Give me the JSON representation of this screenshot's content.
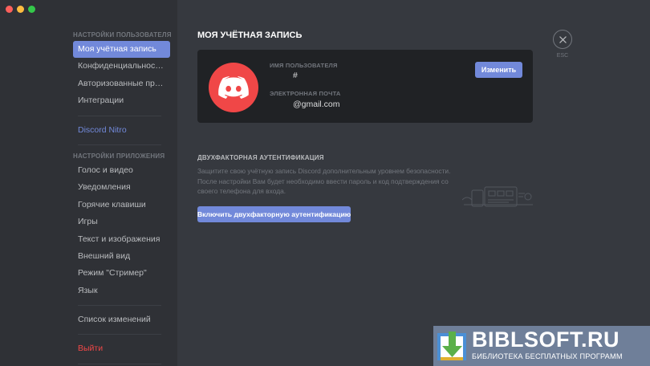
{
  "colors": {
    "window_traffic_lights": [
      "#fc605c",
      "#fdbc40",
      "#34c84a"
    ],
    "accent": "#7289da",
    "danger": "#f04747",
    "avatar_bg": "#f04747"
  },
  "sidebar": {
    "user_settings_header": "НАСТРОЙКИ ПОЛЬЗОВАТЕЛЯ",
    "user_items": [
      {
        "label": "Моя учётная запись",
        "active": true
      },
      {
        "label": "Конфиденциальность ..."
      },
      {
        "label": "Авторизованные прил..."
      },
      {
        "label": "Интеграции"
      }
    ],
    "nitro_label": "Discord Nitro",
    "app_settings_header": "НАСТРОЙКИ ПРИЛОЖЕНИЯ",
    "app_items": [
      {
        "label": "Голос и видео"
      },
      {
        "label": "Уведомления"
      },
      {
        "label": "Горячие клавиши"
      },
      {
        "label": "Игры"
      },
      {
        "label": "Текст и изображения"
      },
      {
        "label": "Внешний вид"
      },
      {
        "label": "Режим \"Стример\""
      },
      {
        "label": "Язык"
      }
    ],
    "changelog_label": "Список изменений",
    "logout_label": "Выйти",
    "social_icons": [
      "twitter-icon",
      "facebook-icon",
      "instagram-icon"
    ]
  },
  "main": {
    "title": "МОЯ УЧЁТНАЯ ЗАПИСЬ",
    "account": {
      "avatar_icon": "discord-logo-icon",
      "username_label": "ИМЯ ПОЛЬЗОВАТЕЛЯ",
      "username_value": "#",
      "email_label": "ЭЛЕКТРОННАЯ ПОЧТА",
      "email_value": "@gmail.com",
      "edit_button": "Изменить"
    },
    "two_factor": {
      "title": "ДВУХФАКТОРНАЯ АУТЕНТИФИКАЦИЯ",
      "description": "Защитите свою учётную запись Discord дополнительным уровнем безопасности. После настройки Вам будет необходимо ввести пароль и код подтверждения со своего телефона для входа.",
      "enable_button": "Включить двухфакторную аутентификацию",
      "illustration_icon": "phone-lock-illustration"
    }
  },
  "close": {
    "icon": "close-icon",
    "label": "ESC"
  },
  "watermark": {
    "title": "BIBLSOFT.RU",
    "subtitle": "БИБЛИОТЕКА БЕСПЛАТНЫХ ПРОГРАММ"
  }
}
